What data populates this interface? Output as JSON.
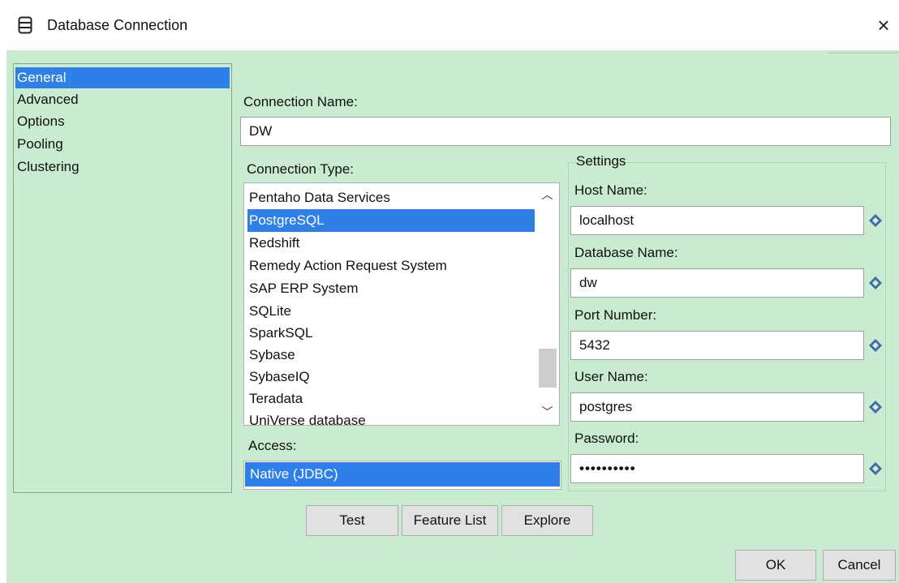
{
  "window": {
    "title": "Database Connection",
    "close_label": "×"
  },
  "nav": {
    "items": [
      "General",
      "Advanced",
      "Options",
      "Pooling",
      "Clustering"
    ]
  },
  "connection_name": {
    "label": "Connection Name:",
    "value": "DW"
  },
  "connection_type": {
    "label": "Connection Type:",
    "items": [
      "Pentaho Data Services",
      "PostgreSQL",
      "Redshift",
      "Remedy Action Request System",
      "SAP ERP System",
      "SQLite",
      "SparkSQL",
      "Sybase",
      "SybaseIQ",
      "Teradata",
      "UniVerse database"
    ],
    "selected": "PostgreSQL"
  },
  "access": {
    "label": "Access:",
    "selected": "Native (JDBC)"
  },
  "settings": {
    "title": "Settings",
    "host": {
      "label": "Host Name:",
      "value": "localhost"
    },
    "database": {
      "label": "Database Name:",
      "value": "dw"
    },
    "port": {
      "label": "Port Number:",
      "value": "5432"
    },
    "user": {
      "label": "User Name:",
      "value": "postgres"
    },
    "password": {
      "label": "Password:",
      "value": "••••••••••"
    }
  },
  "buttons": {
    "test": "Test",
    "feature_list": "Feature List",
    "explore": "Explore",
    "ok": "OK",
    "cancel": "Cancel"
  },
  "colors": {
    "background": "#c9ebd0",
    "selection": "#2e7fe8"
  }
}
